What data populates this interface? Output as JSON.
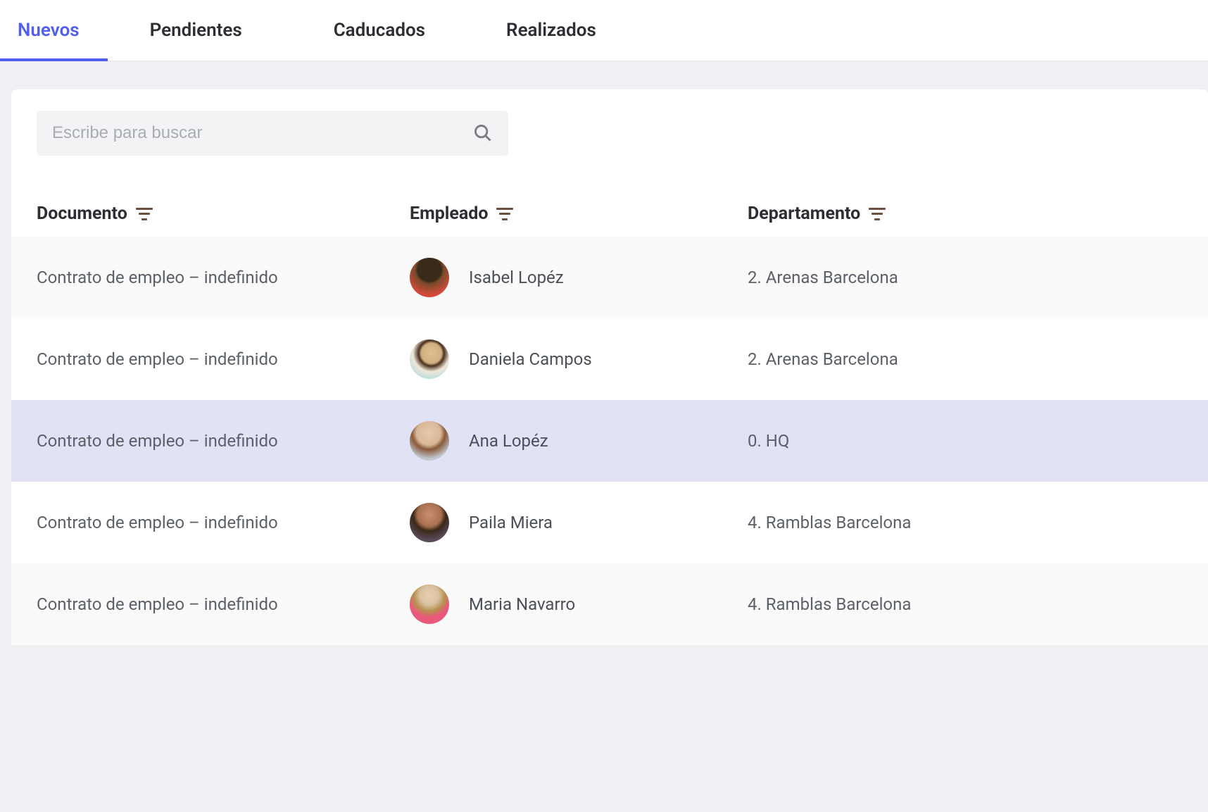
{
  "tabs": [
    {
      "label": "Nuevos",
      "active": true
    },
    {
      "label": "Pendientes",
      "active": false
    },
    {
      "label": "Caducados",
      "active": false
    },
    {
      "label": "Realizados",
      "active": false
    }
  ],
  "search": {
    "placeholder": "Escribe para buscar",
    "value": ""
  },
  "columns": {
    "document": "Documento",
    "employee": "Empleado",
    "department": "Departamento"
  },
  "rows": [
    {
      "document": "Contrato de empleo – indefinido",
      "employee": "Isabel Lopéz",
      "department": "2. Arenas Barcelona",
      "avatar": "av1",
      "selected": false
    },
    {
      "document": "Contrato de empleo – indefinido",
      "employee": "Daniela Campos",
      "department": "2. Arenas Barcelona",
      "avatar": "av2",
      "selected": false
    },
    {
      "document": "Contrato de empleo – indefinido",
      "employee": "Ana Lopéz",
      "department": "0. HQ",
      "avatar": "av3",
      "selected": true
    },
    {
      "document": "Contrato de empleo – indefinido",
      "employee": "Paila Miera",
      "department": "4. Ramblas Barcelona",
      "avatar": "av4",
      "selected": false
    },
    {
      "document": "Contrato de empleo – indefinido",
      "employee": "Maria Navarro",
      "department": "4. Ramblas Barcelona",
      "avatar": "av5",
      "selected": false
    }
  ]
}
